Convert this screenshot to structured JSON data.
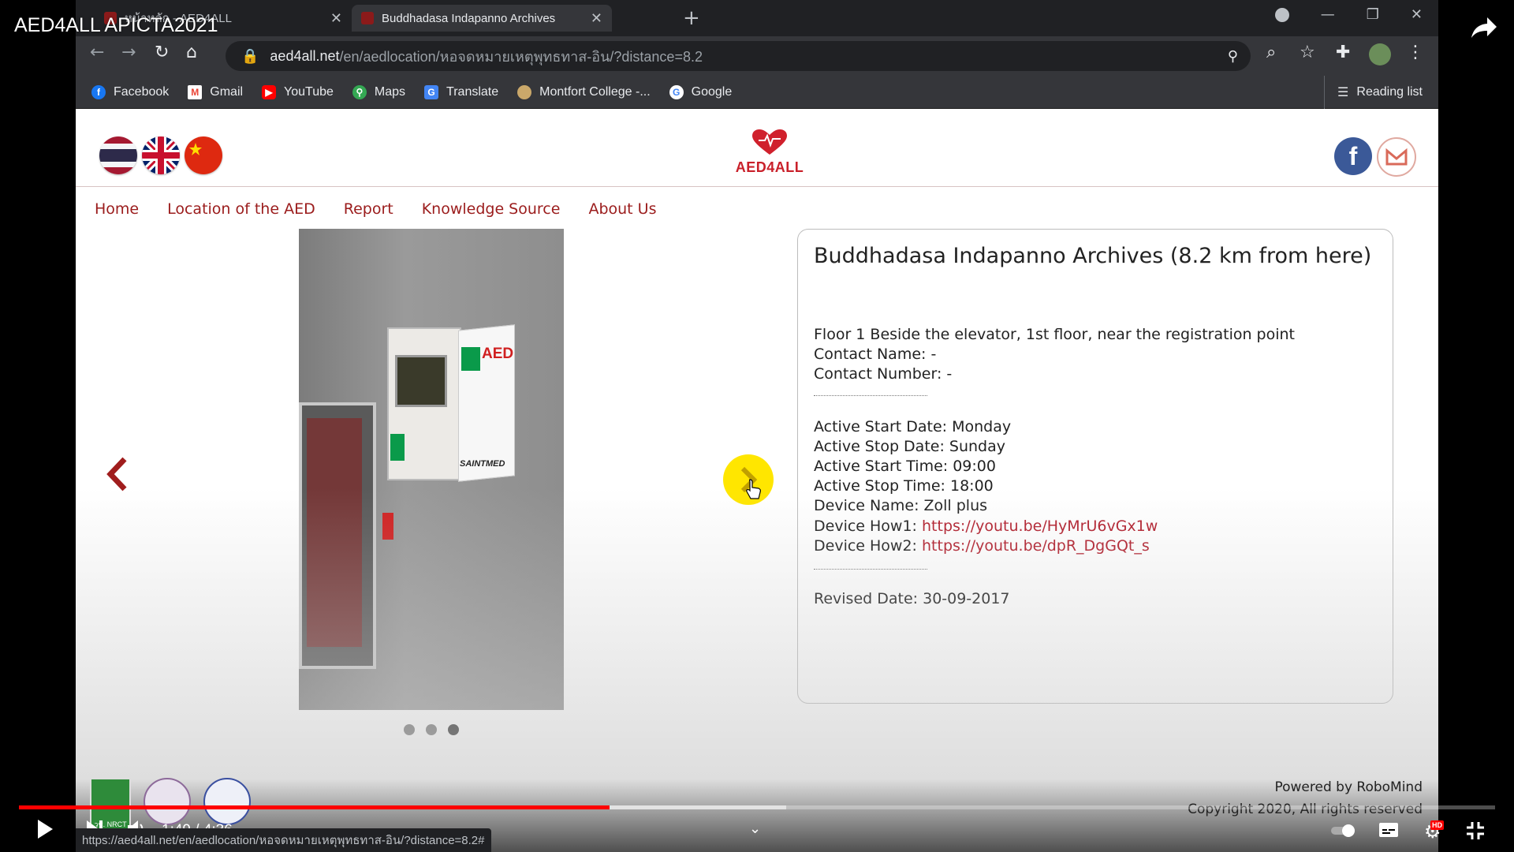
{
  "video": {
    "title": "AED4ALL APICTA2021",
    "time": "1:49 / 4:36",
    "progress_played": 0.4,
    "progress_buffered": 0.52,
    "hd_badge": "HD"
  },
  "browser": {
    "tabs": [
      {
        "label": "หน้าหลัก - AED4ALL",
        "active": false
      },
      {
        "label": "Buddhadasa Indapanno Archives",
        "active": true
      }
    ],
    "url_host": "aed4all.net",
    "url_path": "/en/aedlocation/หอจดหมายเหตุพุทธทาส-อิน/?distance=8.2",
    "bookmarks": [
      {
        "label": "Facebook",
        "icon": "facebook-icon"
      },
      {
        "label": "Gmail",
        "icon": "gmail-icon"
      },
      {
        "label": "YouTube",
        "icon": "youtube-icon"
      },
      {
        "label": "Maps",
        "icon": "maps-icon"
      },
      {
        "label": "Translate",
        "icon": "translate-icon"
      },
      {
        "label": "Montfort College -...",
        "icon": "montfort-icon"
      },
      {
        "label": "Google",
        "icon": "google-icon"
      }
    ],
    "reading_list": "Reading list",
    "status_url": "https://aed4all.net/en/aedlocation/หอจดหมายเหตุพุทธทาส-อิน/?distance=8.2#"
  },
  "site": {
    "logo_text": "AED4ALL",
    "nav": [
      "Home",
      "Location of the AED",
      "Report",
      "Knowledge Source",
      "About Us"
    ],
    "carousel": {
      "slide_count": 3,
      "active_index": 2,
      "slide_label": "AED",
      "slide_brand": "SAINTMED"
    },
    "info": {
      "title": "Buddhadasa Indapanno Archives (8.2 km from here)",
      "location": "Floor 1 Beside the elevator, 1st floor, near the registration point",
      "contact_name": "Contact Name: -",
      "contact_number": "Contact Number: -",
      "active_start_date": "Active Start Date: Monday",
      "active_stop_date": "Active Stop Date: Sunday",
      "active_start_time": "Active Start Time: 09:00",
      "active_stop_time": "Active Stop Time: 18:00",
      "device_name": "Device Name: Zoll plus",
      "how1_label": "Device How1:",
      "how1_url": "https://youtu.be/HyMrU6vGx1w",
      "how2_label": "Device How2:",
      "how2_url": "https://youtu.be/dpR_DgGQt_s",
      "revised": "Revised Date: 30-09-2017"
    },
    "footer": {
      "powered": "Powered by RoboMind",
      "copyright": "Copyright 2020, All rights reserved",
      "seal_text": "วช. NRCT"
    }
  },
  "colors": {
    "brand_red": "#9b1c1c",
    "link_red": "#b21f2d",
    "next_arrow_bg": "#ffe600",
    "yt_red": "#ff0000"
  }
}
